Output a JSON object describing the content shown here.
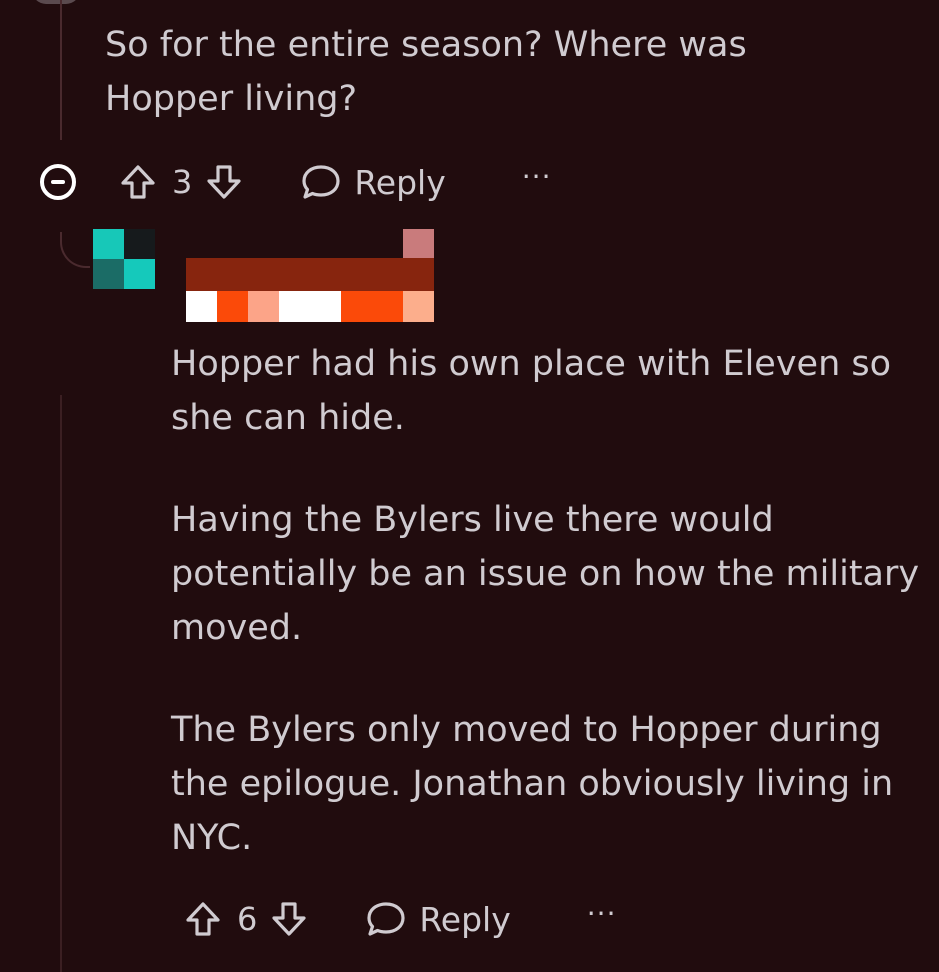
{
  "parent_comment": {
    "text": "So for the entire season? Where was\nHopper living?",
    "upvotes": "3",
    "reply_label": "Reply",
    "more_label": "···"
  },
  "reply_comment": {
    "paragraphs": [
      "Hopper had his own place with Eleven so she can hide.",
      "Having the Bylers live there would potentially be an issue on how the military moved.",
      "The Bylers only moved to Hopper during the epilogue. Jonathan obviously living in NYC."
    ],
    "upvotes": "6",
    "reply_label": "Reply",
    "more_label": "···"
  },
  "colors": {
    "background": "#210c0e",
    "text": "#d0cbd0",
    "avatar_cells": [
      "#17c8b8",
      "#161a1c",
      "#1b6c66",
      "#15c9bb"
    ],
    "redact_row_cells": [
      "#ffffff",
      "#fb4a09",
      "#fca488",
      "#ffffff",
      "#fb4a09",
      "#fcae8c"
    ]
  },
  "icons": {
    "collapse": "minus-circle-icon",
    "upvote": "arrow-up-icon",
    "downvote": "arrow-down-icon",
    "reply": "speech-bubble-icon",
    "more": "ellipsis-icon"
  }
}
